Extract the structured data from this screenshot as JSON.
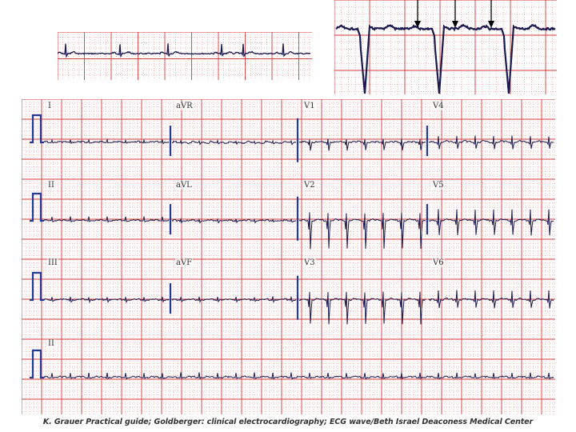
{
  "leads": {
    "row1": [
      "I",
      "aVR",
      "V1",
      "V4"
    ],
    "row2": [
      "II",
      "aVL",
      "V2",
      "V5"
    ],
    "row3": [
      "III",
      "aVF",
      "V3",
      "V6"
    ],
    "rhythm": "II"
  },
  "caption": "K. Grauer Practical guide; Goldberger: clinical electrocardiography; ECG wave/Beth Israel Deaconess Medical Center",
  "colors": {
    "grid_major": "#d63a3a",
    "grid_minor": "#e87a7a",
    "trace": "#1a1a50",
    "annotation_arrow": "#000000",
    "calibration": "#1f3a9a"
  }
}
